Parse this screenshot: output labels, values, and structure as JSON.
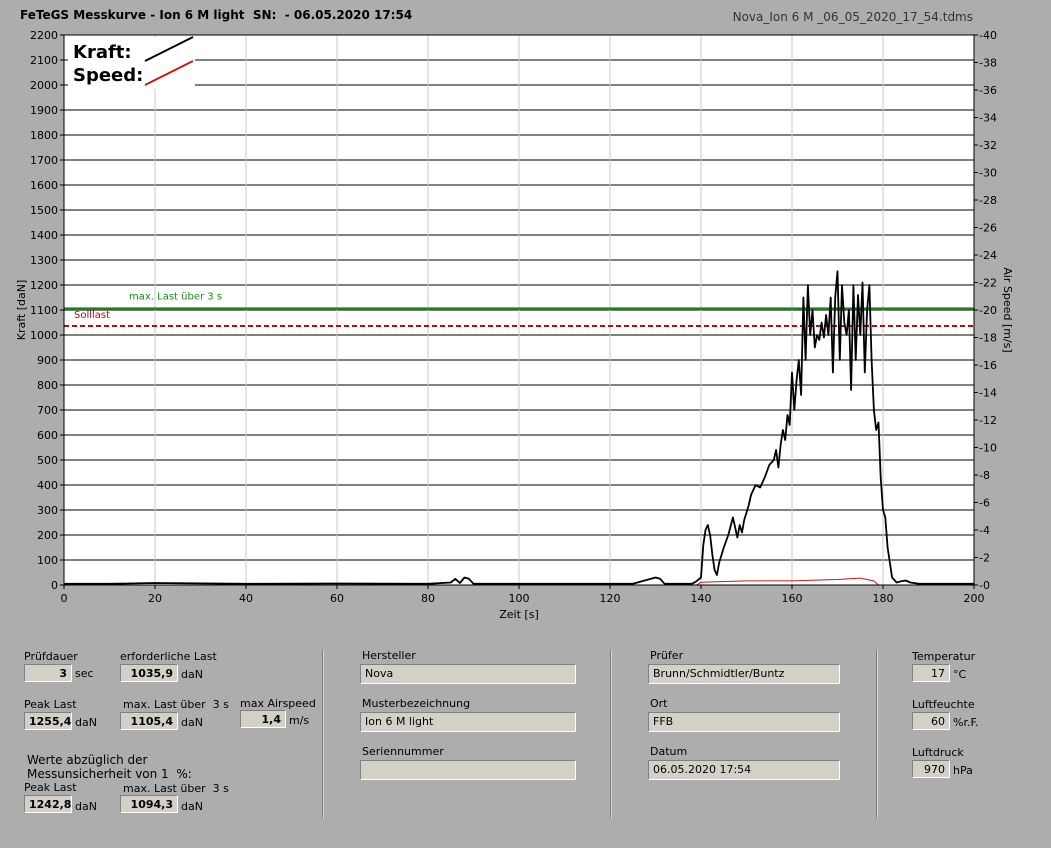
{
  "header": {
    "title": "FeTeGS Messkurve - Ion 6 M light  SN:  - 06.05.2020 17:54",
    "file": "Nova_Ion 6 M _06_05_2020_17_54.tdms"
  },
  "chart_data": {
    "type": "line",
    "xlabel": "Zeit [s]",
    "ylabel": "Kraft [daN]",
    "y2label": "Air Speed [m/s]",
    "xlim": [
      0,
      200
    ],
    "ylim": [
      0,
      2200
    ],
    "y2lim": [
      0,
      40
    ],
    "xticks": [
      "0",
      "20",
      "40",
      "60",
      "80",
      "100",
      "120",
      "140",
      "160",
      "180",
      "200"
    ],
    "yticks": [
      "0",
      "100",
      "200",
      "300",
      "400",
      "500",
      "600",
      "700",
      "800",
      "900",
      "1000",
      "1100",
      "1200",
      "1300",
      "1400",
      "1500",
      "1600",
      "1700",
      "1800",
      "1900",
      "2000",
      "2100",
      "2200"
    ],
    "y2ticks": [
      "0",
      "2",
      "4",
      "6",
      "8",
      "10",
      "12",
      "14",
      "16",
      "18",
      "20",
      "22",
      "24",
      "26",
      "28",
      "30",
      "32",
      "34",
      "36",
      "38",
      "40"
    ],
    "grid": true,
    "legend": {
      "position": "top-left",
      "kraft": "Kraft:",
      "speed": "Speed:"
    },
    "reference_lines": {
      "max_last": {
        "label": "max. Last über  3 s",
        "value": 1105.4,
        "color": "#1a8a1a"
      },
      "solllast": {
        "label": "Solllast",
        "value": 1035.9,
        "color": "#b01010"
      }
    },
    "series": [
      {
        "name": "Kraft",
        "color": "#000000",
        "x": [
          0,
          10,
          20,
          40,
          60,
          80,
          85,
          86,
          87,
          88,
          89,
          90,
          100,
          110,
          125,
          129,
          130,
          131,
          132,
          138,
          139,
          140,
          140.5,
          141,
          141.5,
          142,
          142.5,
          143,
          143.5,
          144,
          145,
          146,
          147,
          148,
          148.5,
          149,
          149.5,
          150,
          150.5,
          151,
          152,
          153,
          154,
          155,
          156,
          156.5,
          157,
          157.5,
          158,
          158.5,
          159,
          159.5,
          160,
          160.5,
          161,
          161.5,
          162,
          162.5,
          163,
          163.5,
          164,
          164.5,
          165,
          165.5,
          166,
          166.5,
          167,
          167.5,
          168,
          168.5,
          169,
          169.5,
          170,
          170.5,
          171,
          171.5,
          172,
          172.5,
          173,
          173.5,
          174,
          174.5,
          175,
          175.5,
          176,
          176.5,
          177,
          177.5,
          178,
          178.5,
          179,
          179.5,
          180,
          180.5,
          181,
          182,
          183,
          184,
          185,
          186,
          188,
          190,
          200
        ],
        "y": [
          5,
          5,
          8,
          5,
          6,
          5,
          10,
          25,
          8,
          30,
          25,
          5,
          5,
          5,
          5,
          25,
          30,
          25,
          5,
          5,
          15,
          30,
          160,
          220,
          240,
          200,
          120,
          60,
          40,
          90,
          150,
          200,
          270,
          190,
          240,
          210,
          260,
          290,
          320,
          360,
          400,
          390,
          430,
          480,
          500,
          540,
          470,
          560,
          620,
          580,
          680,
          640,
          850,
          700,
          820,
          900,
          760,
          1150,
          900,
          1200,
          1000,
          1100,
          950,
          1000,
          980,
          1050,
          990,
          1080,
          1000,
          1150,
          850,
          1150,
          1255,
          900,
          1200,
          1050,
          1000,
          1100,
          780,
          1200,
          900,
          1160,
          1000,
          1210,
          850,
          1100,
          1200,
          900,
          700,
          620,
          650,
          430,
          300,
          270,
          150,
          30,
          10,
          15,
          18,
          10,
          5,
          5,
          5
        ]
      },
      {
        "name": "Speed",
        "color": "#c81818",
        "x": [
          0,
          139,
          140,
          150,
          160,
          170,
          175,
          178,
          179,
          200
        ],
        "y": [
          0,
          0,
          0.2,
          0.3,
          0.3,
          0.4,
          0.5,
          0.3,
          0,
          0
        ]
      }
    ]
  },
  "fields": {
    "pruefdauer": {
      "label": "Prüfdauer",
      "value": "3",
      "unit": "sec"
    },
    "erforderliche_last": {
      "label": "erforderliche Last",
      "value": "1035,9",
      "unit": "daN"
    },
    "peak_last": {
      "label": "Peak Last",
      "value": "1255,4",
      "unit": "daN"
    },
    "max_last": {
      "label": "max. Last über  3 s",
      "value": "1105,4",
      "unit": "daN"
    },
    "max_airspeed": {
      "label": "max Airspeed",
      "value": "1,4",
      "unit": "m/s"
    },
    "werte_note": "Werte abzüglich der\nMessunsicherheit von 1  %:",
    "peak_last2": {
      "label": "Peak Last",
      "value": "1242,8",
      "unit": "daN"
    },
    "max_last2": {
      "label": "max. Last über  3 s",
      "value": "1094,3",
      "unit": "daN"
    },
    "hersteller": {
      "label": "Hersteller",
      "value": "Nova"
    },
    "musterbezeichnung": {
      "label": "Musterbezeichnung",
      "value": "Ion 6 M light"
    },
    "seriennummer": {
      "label": "Seriennummer",
      "value": ""
    },
    "pruefer": {
      "label": "Prüfer",
      "value": "Brunn/Schmidtler/Buntz"
    },
    "ort": {
      "label": "Ort",
      "value": "FFB"
    },
    "datum": {
      "label": "Datum",
      "value": "06.05.2020 17:54"
    },
    "temperatur": {
      "label": "Temperatur",
      "value": "17",
      "unit": "°C"
    },
    "luftfeuchte": {
      "label": "Luftfeuchte",
      "value": "60",
      "unit": "%r.F."
    },
    "luftdruck": {
      "label": "Luftdruck",
      "value": "970",
      "unit": "hPa"
    }
  }
}
